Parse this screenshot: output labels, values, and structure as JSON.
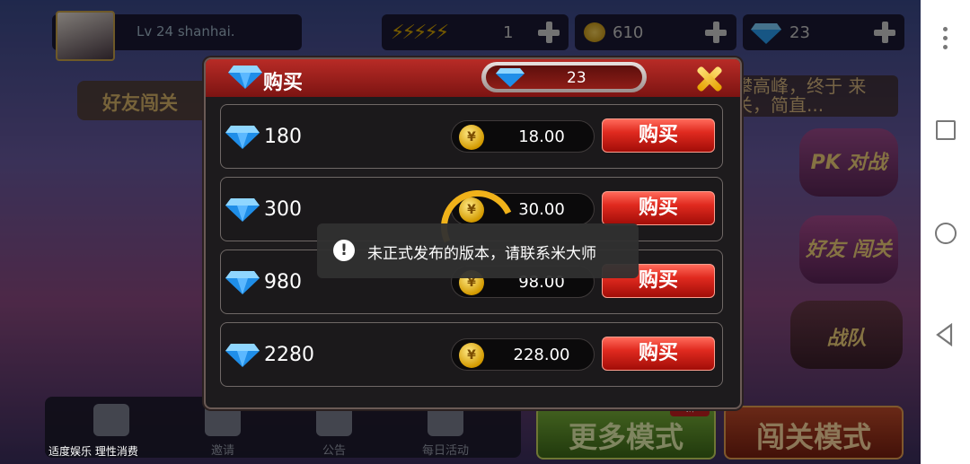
{
  "topbar": {
    "level_text": "Lv 24 shanhai.",
    "energy_value": "1",
    "coins_value": "610",
    "gems_value": "23"
  },
  "background": {
    "friend_banner": "好友闯关",
    "side_text": "攀高峰，终于 来关，简直...",
    "mode_pk_label": "PK 对战",
    "mode_friend_label": "好友 闯关",
    "mode_team_label": "战队",
    "more_modes": "更多模式",
    "stage_mode": "闯关模式",
    "new_tag": "新",
    "footer_note": "适度娱乐 理性消费",
    "nav": [
      {
        "label": ""
      },
      {
        "label": "邀请"
      },
      {
        "label": "公告"
      },
      {
        "label": "每日活动"
      }
    ]
  },
  "dialog": {
    "title": "购买",
    "balance": "23",
    "packages": [
      {
        "amount": "180",
        "price": "18.00",
        "button": "购买"
      },
      {
        "amount": "300",
        "price": "30.00",
        "button": "购买"
      },
      {
        "amount": "980",
        "price": "98.00",
        "button": "购买"
      },
      {
        "amount": "2280",
        "price": "228.00",
        "button": "购买"
      }
    ]
  },
  "toast": {
    "message": "未正式发布的版本，请联系米大师"
  },
  "colors": {
    "header_red": "#b82b26",
    "button_red": "#e02a1f",
    "coin_gold": "#f0b21a"
  }
}
